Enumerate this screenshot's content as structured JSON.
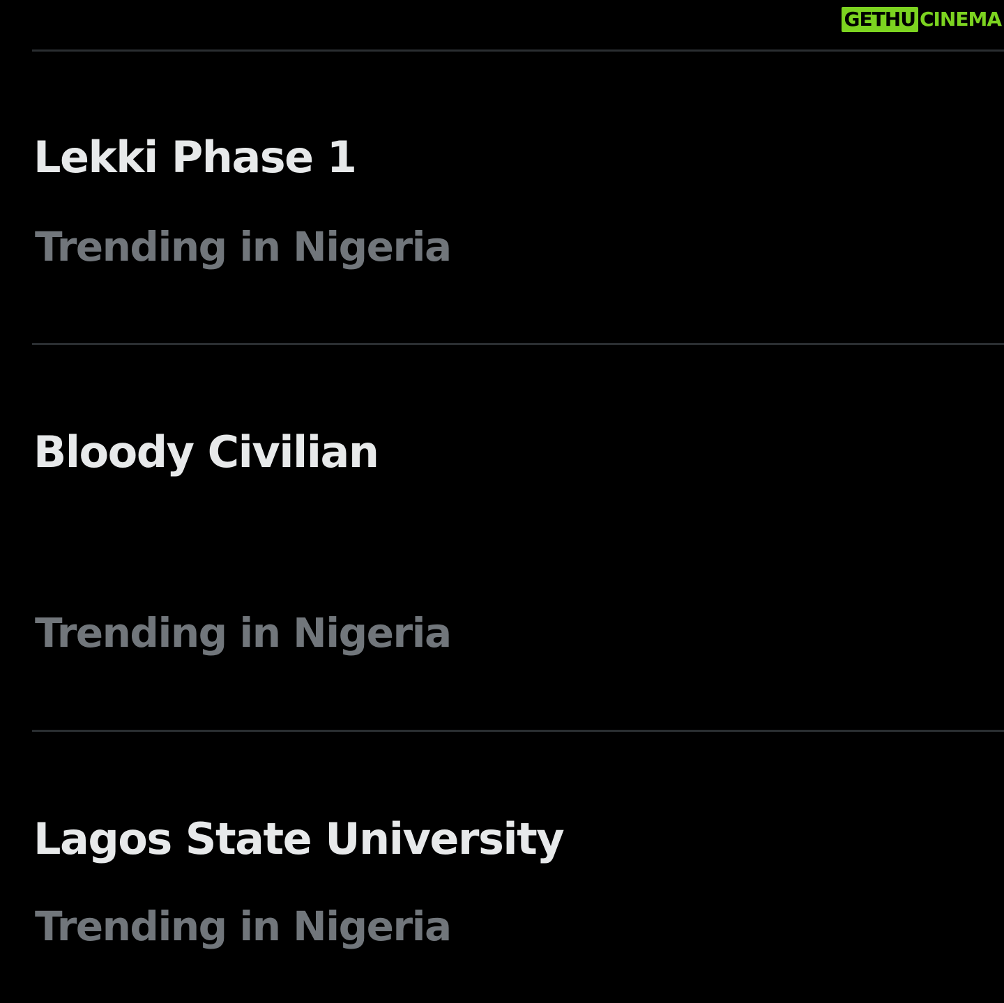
{
  "watermark": {
    "part1": "GETHU",
    "part2": "CINEMA",
    "color": "#7cd320"
  },
  "trends": [
    {
      "title": "Lekki Phase 1",
      "meta": "Trending in Nigeria"
    },
    {
      "title": "Bloody Civilian",
      "meta": "Trending in Nigeria"
    },
    {
      "title": "Lagos State University",
      "meta": "Trending in Nigeria"
    }
  ],
  "colors": {
    "background": "#000000",
    "title_text": "#e7e9ea",
    "meta_text": "#71767b",
    "divider": "#2a2e31"
  }
}
